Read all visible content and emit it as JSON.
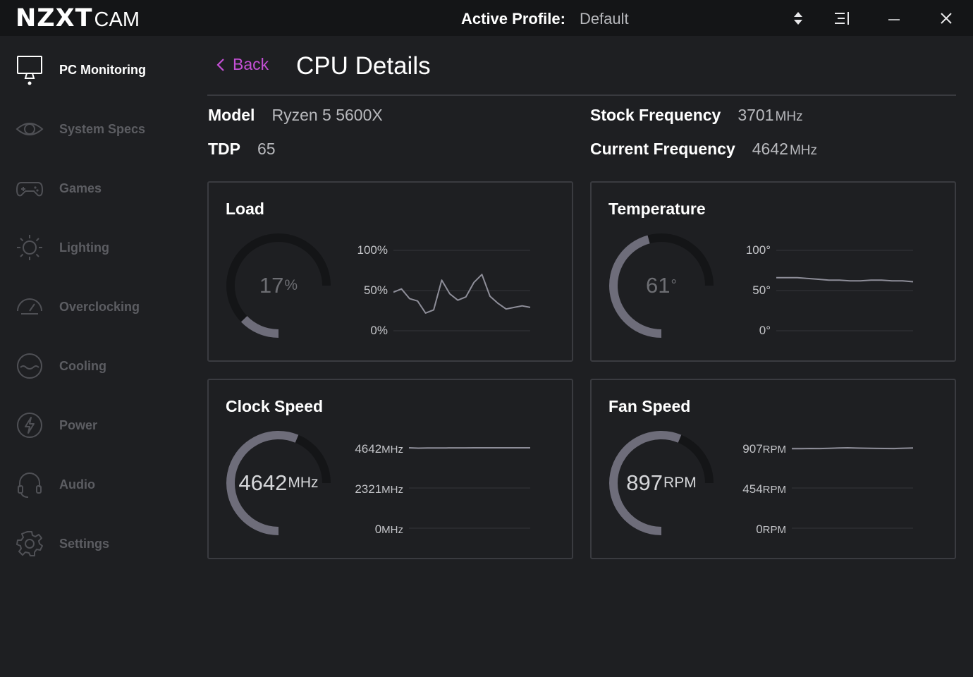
{
  "titlebar": {
    "logo_main": "NZXT",
    "logo_sub": "CAM",
    "profile_label": "Active Profile:",
    "profile_value": "Default"
  },
  "sidebar": {
    "items": [
      {
        "label": "PC Monitoring",
        "icon": "monitor-icon",
        "active": true
      },
      {
        "label": "System Specs",
        "icon": "eye-icon"
      },
      {
        "label": "Games",
        "icon": "gamepad-icon"
      },
      {
        "label": "Lighting",
        "icon": "sun-icon"
      },
      {
        "label": "Overclocking",
        "icon": "gauge-icon"
      },
      {
        "label": "Cooling",
        "icon": "water-icon"
      },
      {
        "label": "Power",
        "icon": "bolt-icon"
      },
      {
        "label": "Audio",
        "icon": "headset-icon"
      },
      {
        "label": "Settings",
        "icon": "gear-icon"
      }
    ]
  },
  "header": {
    "back_label": "Back",
    "title": "CPU Details"
  },
  "specs": {
    "model_label": "Model",
    "model_value": "Ryzen 5 5600X",
    "tdp_label": "TDP",
    "tdp_value": "65",
    "stock_label": "Stock Frequency",
    "stock_value": "3701",
    "stock_unit": "MHz",
    "current_label": "Current Frequency",
    "current_value": "4642",
    "current_unit": "MHz"
  },
  "colors": {
    "accent": "#c550d6",
    "gauge_fill": "#6e6d7a",
    "gauge_track": "#141517",
    "line": "#8e8e99"
  },
  "cards": {
    "load": {
      "title": "Load",
      "value": "17",
      "unit": "%",
      "fraction": 0.17,
      "axis": [
        {
          "num": "100",
          "unit": "%"
        },
        {
          "num": "50",
          "unit": "%"
        },
        {
          "num": "0",
          "unit": "%"
        }
      ],
      "history": [
        48,
        52,
        40,
        37,
        22,
        26,
        63,
        46,
        38,
        42,
        60,
        70,
        43,
        34,
        27,
        29,
        31,
        29
      ]
    },
    "temperature": {
      "title": "Temperature",
      "value": "61",
      "unit": "°",
      "fraction": 0.61,
      "axis": [
        {
          "num": "100",
          "unit": "°"
        },
        {
          "num": "50",
          "unit": "°"
        },
        {
          "num": "0",
          "unit": "°"
        }
      ],
      "history": [
        66,
        66,
        66,
        65,
        64,
        63,
        63,
        62,
        62,
        63,
        63,
        62,
        62,
        61
      ]
    },
    "clock": {
      "title": "Clock Speed",
      "value": "4642",
      "unit": "MHz",
      "fraction": 0.75,
      "axis": [
        {
          "num": "4642",
          "unit": "MHz"
        },
        {
          "num": "2321",
          "unit": "MHz"
        },
        {
          "num": "0",
          "unit": "MHz"
        }
      ],
      "history": [
        4642,
        4620,
        4630,
        4632,
        4634,
        4636,
        4638,
        4640,
        4640,
        4641,
        4641,
        4642,
        4642,
        4642
      ]
    },
    "fan": {
      "title": "Fan Speed",
      "value": "897",
      "unit": "RPM",
      "fraction": 0.75,
      "axis": [
        {
          "num": "907",
          "unit": "RPM"
        },
        {
          "num": "454",
          "unit": "RPM"
        },
        {
          "num": "0",
          "unit": "RPM"
        }
      ],
      "history": [
        897,
        897,
        899,
        898,
        901,
        905,
        907,
        904,
        902,
        900,
        899,
        898,
        902,
        905
      ]
    }
  }
}
